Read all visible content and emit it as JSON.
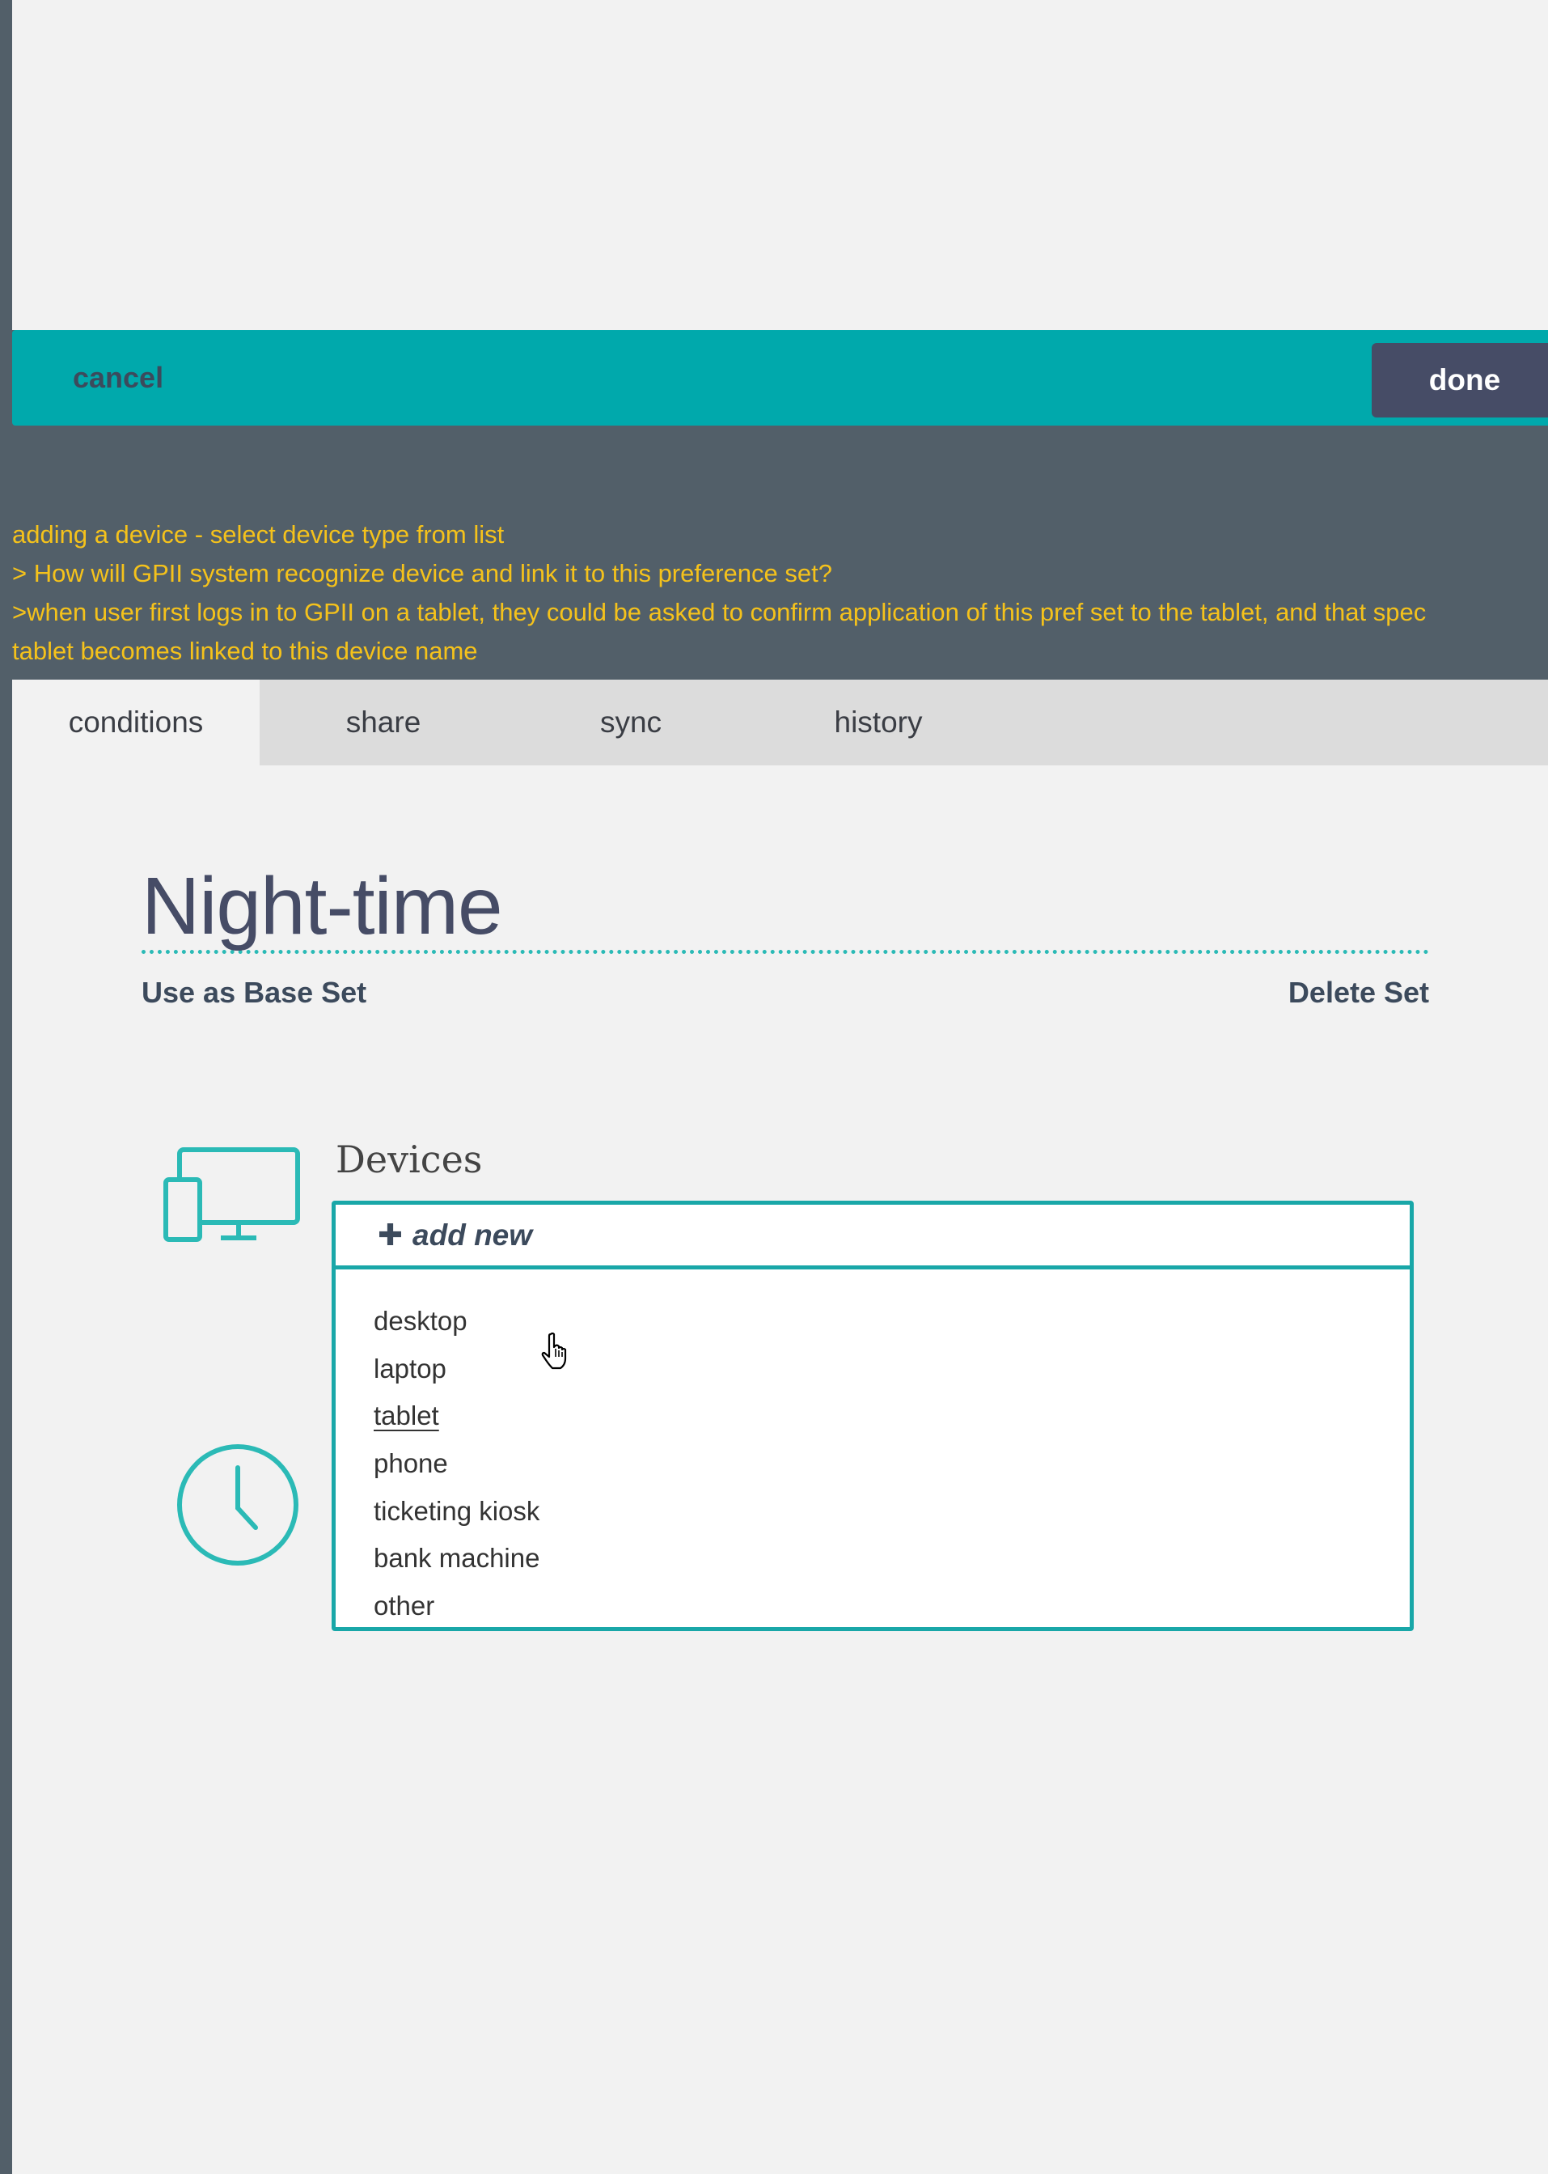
{
  "action_bar": {
    "cancel_label": "cancel",
    "done_label": "done"
  },
  "notes": [
    "adding a device - select device type from list",
    "> How will GPII system recognize device and link it to this preference set?",
    ">when user first logs in to GPII on a tablet, they could be asked to confirm application of this pref set to the tablet, and that spec",
    "tablet becomes linked to this device name"
  ],
  "tabs": [
    {
      "label": "conditions",
      "active": true
    },
    {
      "label": "share"
    },
    {
      "label": "sync"
    },
    {
      "label": "history"
    }
  ],
  "set": {
    "title": "Night-time",
    "base_set_label": "Use as Base Set",
    "delete_label": "Delete Set"
  },
  "devices": {
    "heading": "Devices",
    "add_new_label": "add new",
    "icon": "devices-icon",
    "options": [
      "desktop",
      "laptop",
      "tablet",
      "phone",
      "ticketing kiosk",
      "bank machine",
      "other"
    ],
    "hovered": "tablet"
  },
  "time_icon": "clock-icon",
  "colors": {
    "teal": "#00a9ac",
    "dark_navy": "#464c66",
    "slate_bg": "#525f69",
    "note_yellow": "#f5c21b",
    "panel": "#f2f2f2"
  }
}
